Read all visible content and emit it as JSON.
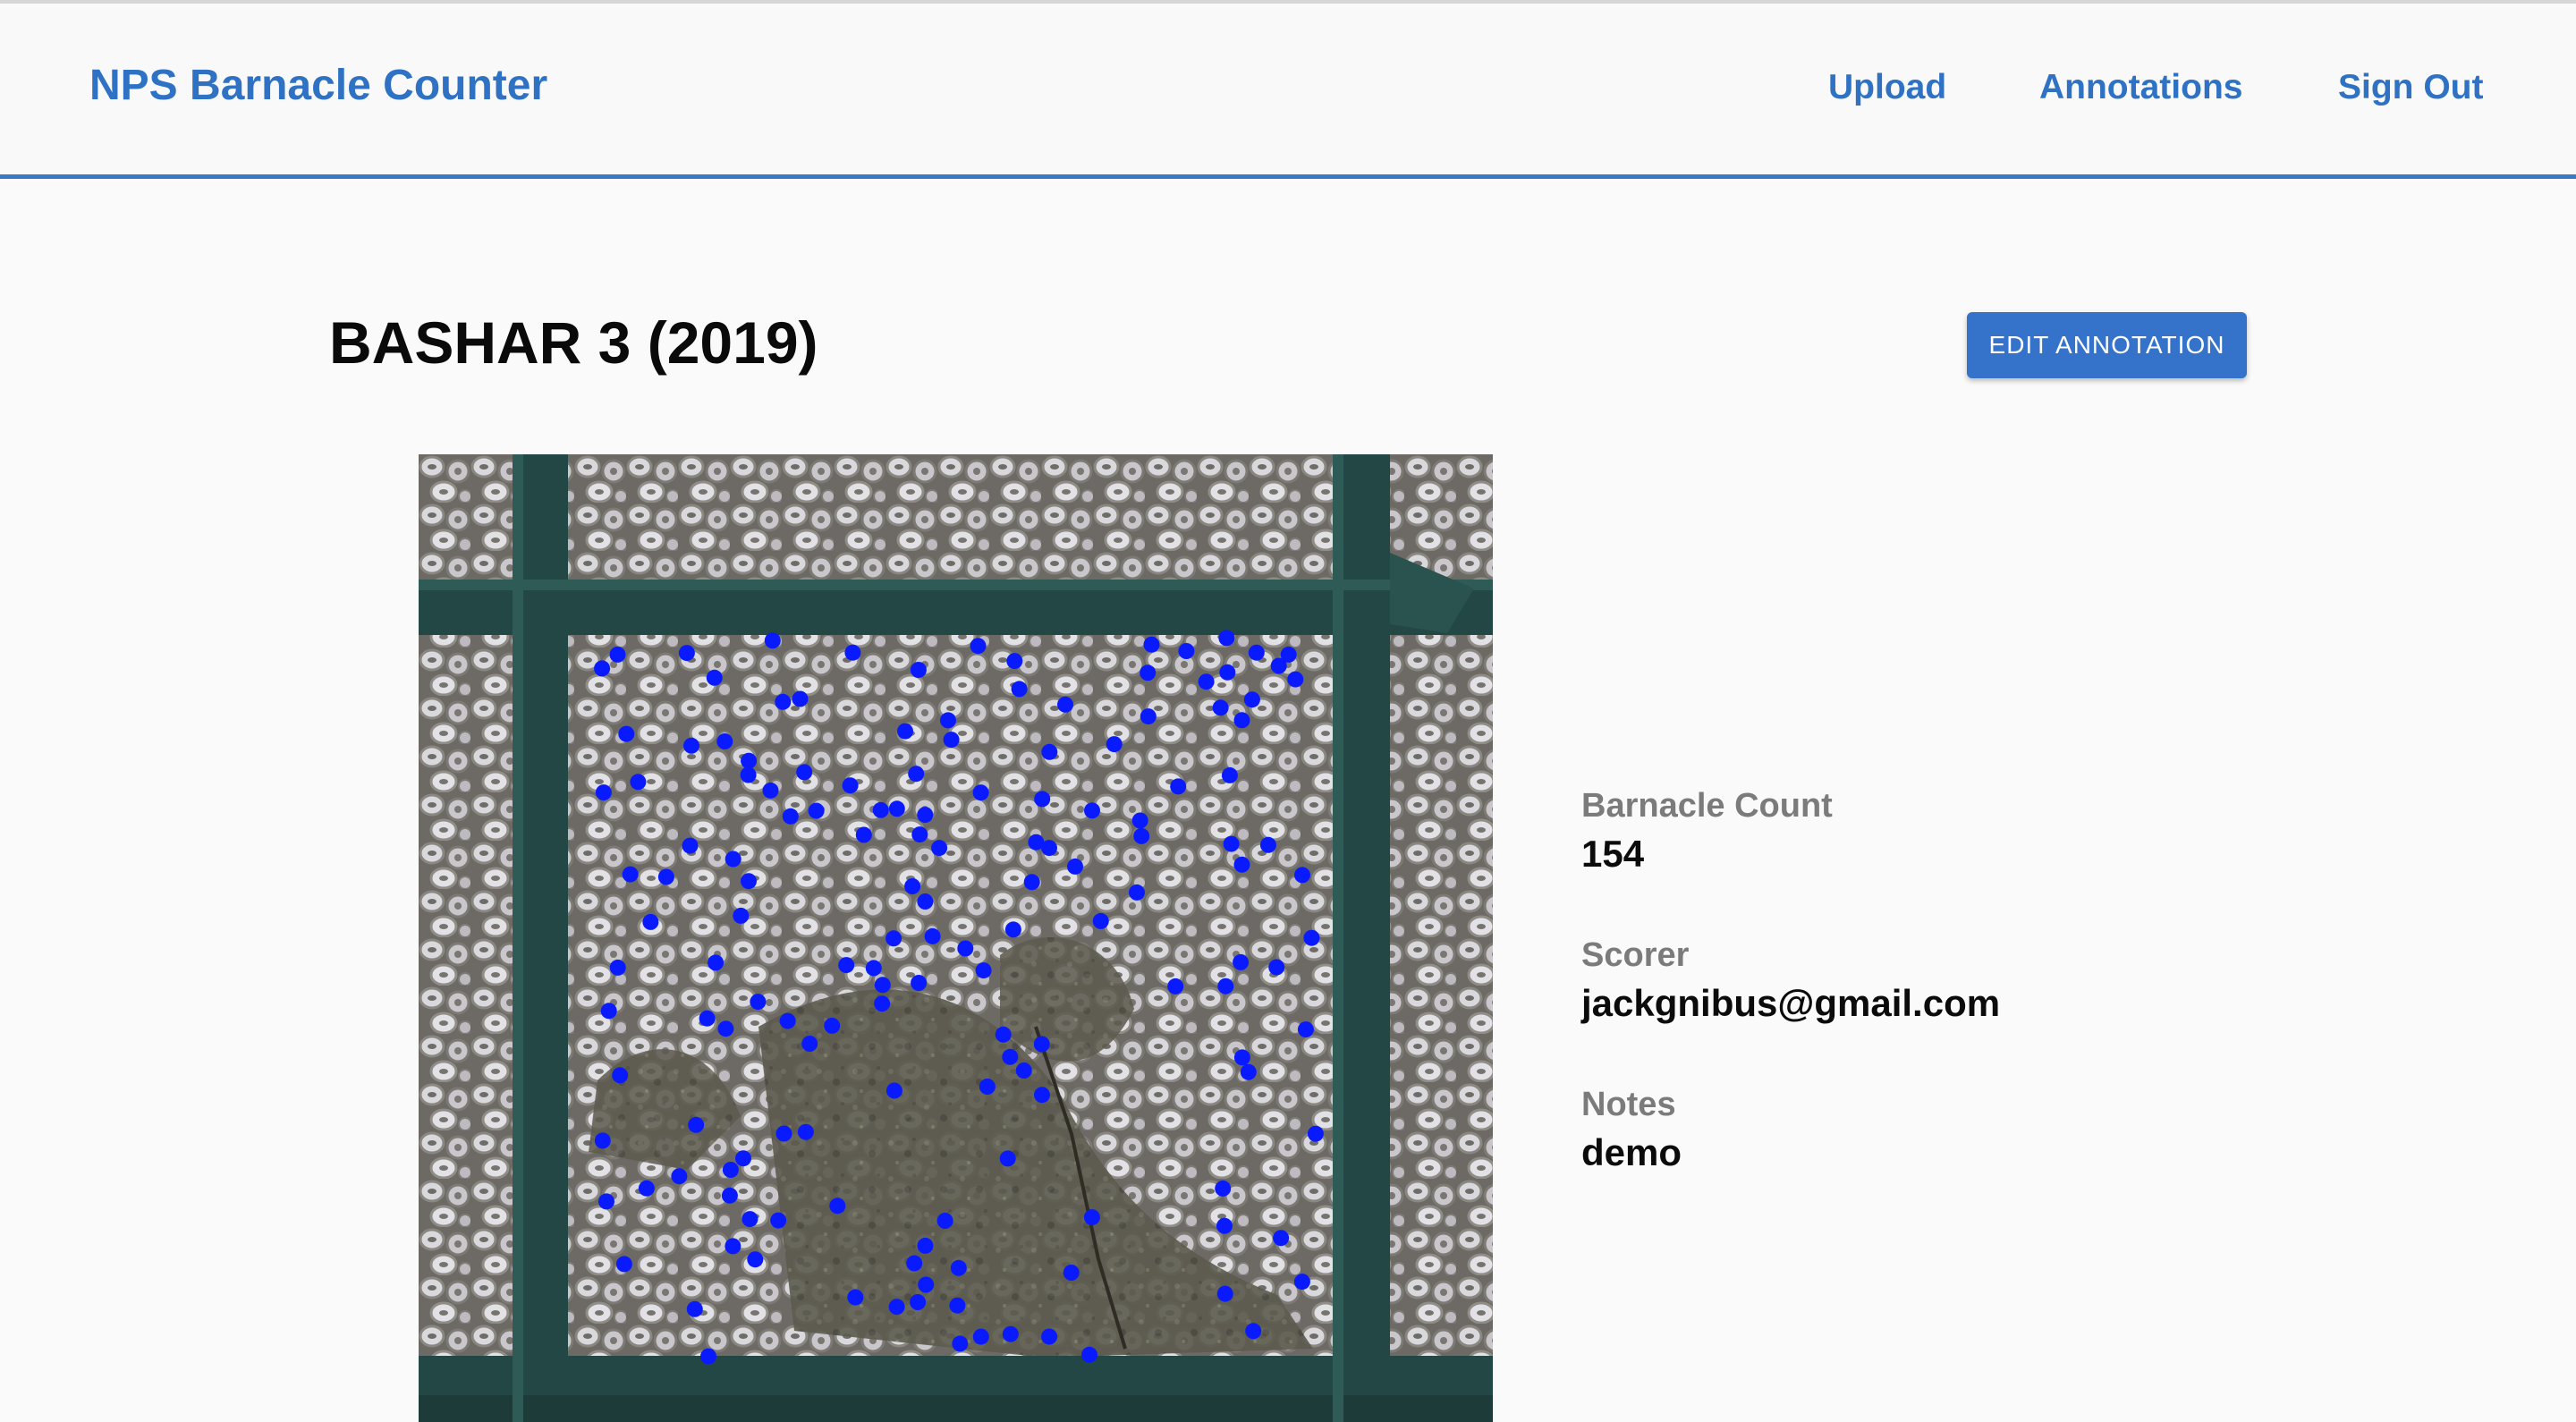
{
  "header": {
    "brand": "NPS Barnacle Counter",
    "nav": [
      {
        "label": "Upload"
      },
      {
        "label": "Annotations"
      },
      {
        "label": "Sign Out"
      }
    ]
  },
  "main": {
    "title": "BASHAR 3 (2019)",
    "edit_label": "EDIT ANNOTATION"
  },
  "details": {
    "count_label": "Barnacle Count",
    "count_value": "154",
    "scorer_label": "Scorer",
    "scorer_value": "jackgnibus@gmail.com",
    "notes_label": "Notes",
    "notes_value": "demo"
  },
  "colors": {
    "accent": "#3473c9",
    "marker": "#0a1aff",
    "frame": "#244744"
  }
}
